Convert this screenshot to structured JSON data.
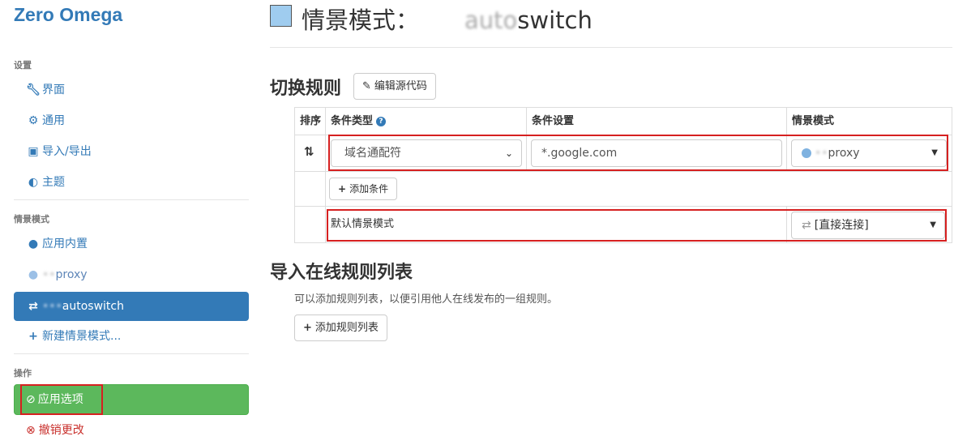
{
  "sidebar": {
    "brand": "Zero Omega",
    "settings_header": "设置",
    "settings_items": [
      {
        "label": "界面",
        "icon": "wrench-icon"
      },
      {
        "label": "通用",
        "icon": "gear-icon"
      },
      {
        "label": "导入/导出",
        "icon": "save-icon"
      },
      {
        "label": "主题",
        "icon": "contrast-icon"
      }
    ],
    "profiles_header": "情景模式",
    "profiles": [
      {
        "label": "应用内置",
        "icon": "globe-icon"
      },
      {
        "label": "proxy",
        "icon": "globe-icon",
        "blurred_prefix": "••"
      },
      {
        "label": "autoswitch",
        "icon": "switch-icon",
        "blurred_prefix": "•••"
      },
      {
        "label": "新建情景模式...",
        "icon": "plus-icon"
      }
    ],
    "actions_header": "操作",
    "apply_label": "应用选项",
    "revert_label": "撤销更改"
  },
  "header": {
    "title_prefix": "情景模式：",
    "title_blurred": "auto",
    "title_suffix": "switch",
    "swatch_color": "#9fccef"
  },
  "switch_rules": {
    "heading": "切换规则",
    "edit_source_label": "编辑源代码",
    "columns": {
      "sort": "排序",
      "condition_type": "条件类型",
      "condition_settings": "条件设置",
      "profile": "情景模式"
    },
    "rules": [
      {
        "condition_type": "域名通配符",
        "pattern": "*.google.com",
        "profile": "proxy",
        "profile_blurred_prefix": "••"
      }
    ],
    "add_condition_label": "添加条件",
    "default_label": "默认情景模式",
    "default_profile": "[直接连接]"
  },
  "rule_list": {
    "heading": "导入在线规则列表",
    "description": "可以添加规则列表，以便引用他人在线发布的一组规则。",
    "add_label": "添加规则列表"
  },
  "colors": {
    "accent": "#337ab7",
    "apply_green": "#5cb85c",
    "annotation_red": "#d62020"
  }
}
